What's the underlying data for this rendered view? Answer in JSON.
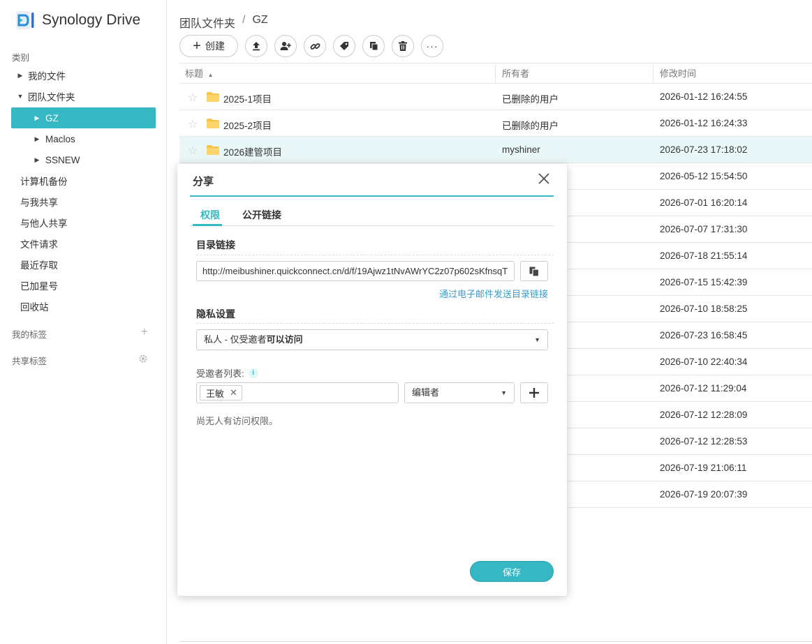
{
  "app": {
    "name": "Synology Drive",
    "accent": "#35b7c4"
  },
  "sidebar": {
    "category_label": "类别",
    "items": [
      {
        "label": "我的文件"
      },
      {
        "label": "团队文件夹"
      },
      {
        "label": "GZ"
      },
      {
        "label": "Maclos"
      },
      {
        "label": "SSNEW"
      },
      {
        "label": "计算机备份"
      },
      {
        "label": "与我共享"
      },
      {
        "label": "与他人共享"
      },
      {
        "label": "文件请求"
      },
      {
        "label": "最近存取"
      },
      {
        "label": "已加星号"
      },
      {
        "label": "回收站"
      }
    ],
    "my_tags_label": "我的标签",
    "shared_tags_label": "共享标签"
  },
  "breadcrumb": {
    "root": "团队文件夹",
    "separator": "/",
    "current": "GZ"
  },
  "toolbar": {
    "create_label": "创建"
  },
  "table": {
    "columns": {
      "title": "标题",
      "owner": "所有者",
      "modified": "修改时间"
    },
    "rows": [
      {
        "name": "2025-1项目",
        "owner": "已删除的用户",
        "mtime": "2026-01-12 16:24:55"
      },
      {
        "name": "2025-2项目",
        "owner": "已删除的用户",
        "mtime": "2026-01-12 16:24:33"
      },
      {
        "name": "2026建管项目",
        "owner": "myshiner",
        "mtime": "2026-07-23 17:18:02"
      },
      {
        "name": "",
        "owner": "",
        "mtime": "2026-05-12 15:54:50"
      },
      {
        "name": "",
        "owner": "",
        "mtime": "2026-07-01 16:20:14"
      },
      {
        "name": "",
        "owner": "",
        "mtime": "2026-07-07 17:31:30"
      },
      {
        "name": "",
        "owner": "",
        "mtime": "2026-07-18 21:55:14"
      },
      {
        "name": "",
        "owner": "",
        "mtime": "2026-07-15 15:42:39"
      },
      {
        "name": "",
        "owner": "",
        "mtime": "2026-07-10 18:58:25"
      },
      {
        "name": "",
        "owner": "",
        "mtime": "2026-07-23 16:58:45"
      },
      {
        "name": "",
        "owner": "",
        "mtime": "2026-07-10 22:40:34"
      },
      {
        "name": "",
        "owner": "",
        "mtime": "2026-07-12 11:29:04"
      },
      {
        "name": "",
        "owner": "",
        "mtime": "2026-07-12 12:28:09"
      },
      {
        "name": "",
        "owner": "",
        "mtime": "2026-07-12 12:28:53"
      },
      {
        "name": "",
        "owner": "",
        "mtime": "2026-07-19 21:06:11"
      },
      {
        "name": "",
        "owner": "",
        "mtime": "2026-07-19 20:07:39"
      }
    ]
  },
  "dialog": {
    "title": "分享",
    "tabs": {
      "permissions": "权限",
      "public_link": "公开链接"
    },
    "link_section_title": "目录链接",
    "link_url": "http://meibushiner.quickconnect.cn/d/f/19Ajwz1tNvAWrYC2z07p602sKfnsqT",
    "email_link": "通过电子邮件发送目录链接",
    "privacy_section_title": "隐私设置",
    "privacy_value_prefix": "私人 - 仅受邀者",
    "privacy_value_bold": "可以访问",
    "invitee_label": "受邀者列表:",
    "invitee_chip": "王敏",
    "role_value": "编辑者",
    "no_access_text": "尚无人有访问权限。",
    "save_label": "保存"
  }
}
